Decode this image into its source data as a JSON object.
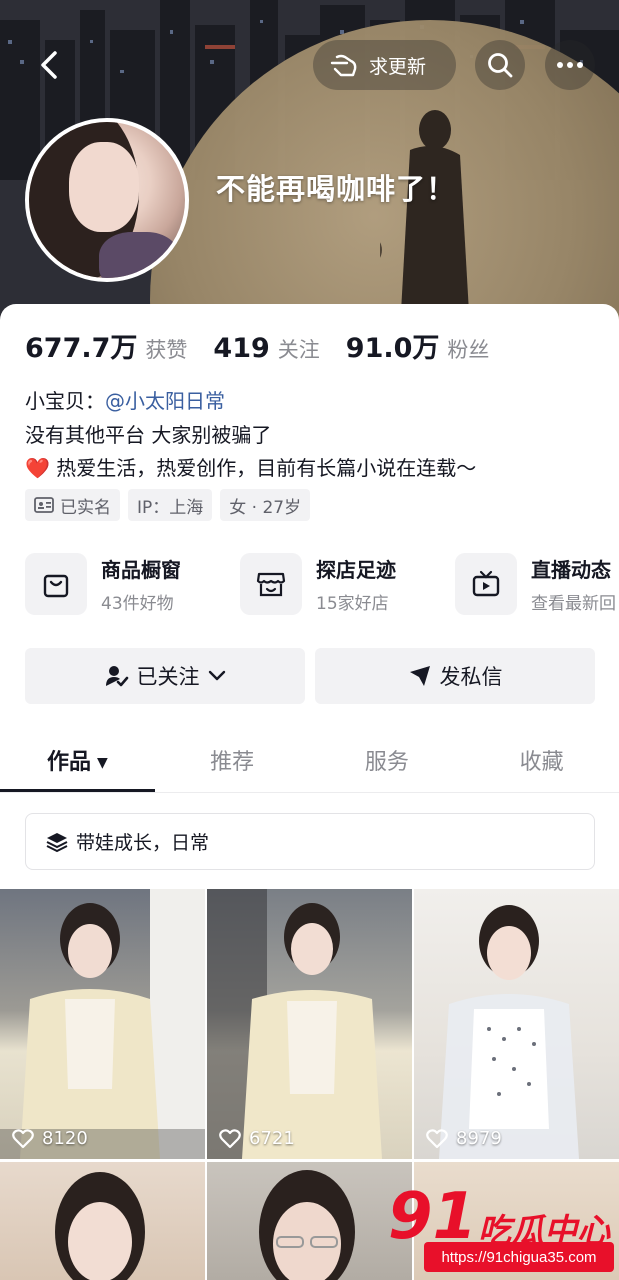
{
  "header": {
    "refresh_label": "求更新",
    "nickname": "不能再喝咖啡了！"
  },
  "stats": [
    {
      "value": "677.7万",
      "label": "获赞"
    },
    {
      "value": "419",
      "label": "关注"
    },
    {
      "value": "91.0万",
      "label": "粉丝"
    }
  ],
  "bio": {
    "line1_prefix": "小宝贝：",
    "line1_mention": "@小太阳日常",
    "line2": "没有其他平台 大家别被骗了",
    "line3_heart": "❤️",
    "line3": "热爱生活，热爱创作，目前有长篇小说在连载～"
  },
  "tags": [
    {
      "label": "已实名"
    },
    {
      "label": "IP：上海"
    },
    {
      "label": "女 · 27岁"
    }
  ],
  "services": [
    {
      "title": "商品橱窗",
      "subtitle": "43件好物",
      "icon": "bag-icon"
    },
    {
      "title": "探店足迹",
      "subtitle": "15家好店",
      "icon": "store-icon"
    },
    {
      "title": "直播动态",
      "subtitle": "查看最新回",
      "icon": "tv-icon"
    }
  ],
  "actions": {
    "follow_label": "已关注",
    "message_label": "发私信"
  },
  "tabs": [
    {
      "label": "作品"
    },
    {
      "label": "推荐"
    },
    {
      "label": "服务"
    },
    {
      "label": "收藏"
    }
  ],
  "collection_label": "带娃成长，日常",
  "videos": [
    {
      "likes": "8120"
    },
    {
      "likes": "6721"
    },
    {
      "likes": "8979"
    }
  ],
  "watermark": {
    "number": "91",
    "brand": "吃瓜中心",
    "url": "https://91chigua35.com"
  },
  "colors": {
    "mention": "#3a5fa0",
    "watermark_red": "#e8102a",
    "chip_bg": "#f2f2f4"
  }
}
